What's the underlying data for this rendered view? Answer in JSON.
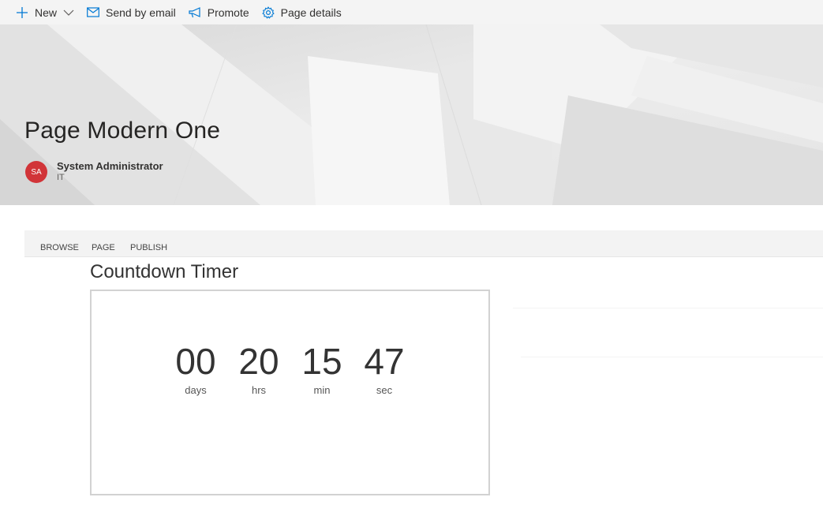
{
  "commandbar": {
    "new_label": "New",
    "email_label": "Send by email",
    "promote_label": "Promote",
    "details_label": "Page details"
  },
  "header": {
    "title": "Page Modern One",
    "author": {
      "initials": "SA",
      "name": "System Administrator",
      "department": "IT",
      "avatar_color": "#d13438"
    }
  },
  "ribbon": {
    "tabs": [
      "BROWSE",
      "PAGE",
      "PUBLISH"
    ]
  },
  "webpart": {
    "title": "Countdown Timer",
    "units": [
      {
        "value": "00",
        "label": "days"
      },
      {
        "value": "20",
        "label": "hrs"
      },
      {
        "value": "15",
        "label": "min"
      },
      {
        "value": "47",
        "label": "sec"
      }
    ]
  },
  "icons": {
    "new": "plus-icon",
    "new_menu": "chevron-down-icon",
    "email": "mail-icon",
    "promote": "megaphone-icon",
    "details": "gear-icon"
  },
  "colors": {
    "accent": "#0078d4",
    "avatar": "#d13438"
  }
}
